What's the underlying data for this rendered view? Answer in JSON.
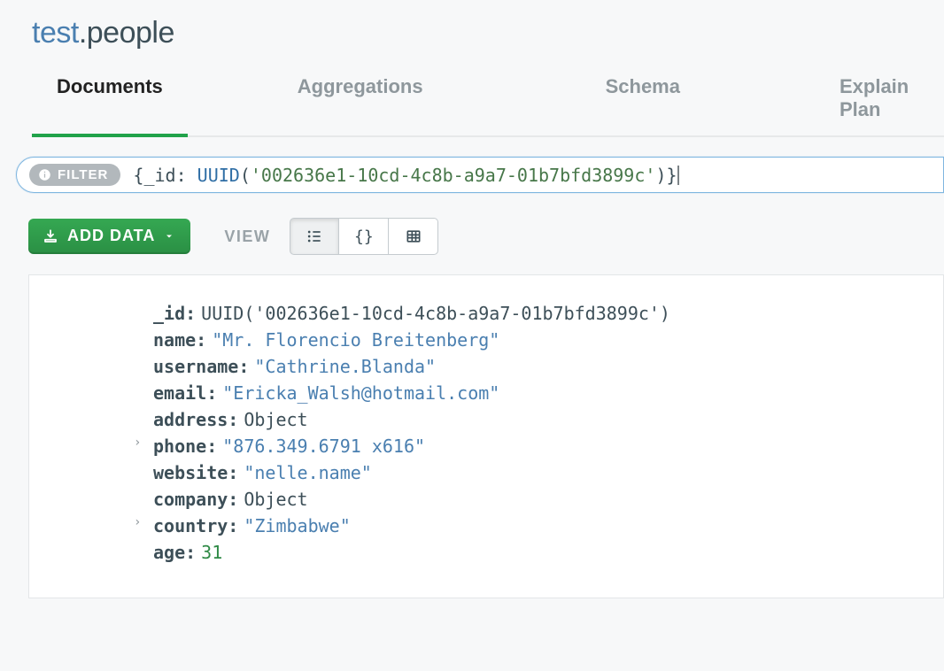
{
  "namespace": {
    "db": "test",
    "coll": ".people"
  },
  "tabs": [
    {
      "label": "Documents",
      "active": true
    },
    {
      "label": "Aggregations",
      "active": false
    },
    {
      "label": "Schema",
      "active": false
    },
    {
      "label": "Explain Plan",
      "active": false
    }
  ],
  "filter": {
    "chip_label": "FILTER",
    "query_tokens": {
      "open": "{",
      "field": "_id",
      "sep": ": ",
      "func": "UUID",
      "lparen": "(",
      "str": "'002636e1-10cd-4c8b-a9a7-01b7bfd3899c'",
      "rparen": ")",
      "close": "}"
    }
  },
  "toolbar": {
    "add_data_label": "ADD DATA",
    "view_label": "VIEW"
  },
  "document": {
    "fields": [
      {
        "key": "_id",
        "type": "func",
        "value": "UUID('002636e1-10cd-4c8b-a9a7-01b7bfd3899c')"
      },
      {
        "key": "name",
        "type": "string",
        "value": "\"Mr. Florencio Breitenberg\""
      },
      {
        "key": "username",
        "type": "string",
        "value": "\"Cathrine.Blanda\""
      },
      {
        "key": "email",
        "type": "string",
        "value": "\"Ericka_Walsh@hotmail.com\""
      },
      {
        "key": "address",
        "type": "object",
        "value": "Object",
        "expandable": true
      },
      {
        "key": "phone",
        "type": "string",
        "value": "\"876.349.6791 x616\""
      },
      {
        "key": "website",
        "type": "string",
        "value": "\"nelle.name\""
      },
      {
        "key": "company",
        "type": "object",
        "value": "Object",
        "expandable": true
      },
      {
        "key": "country",
        "type": "string",
        "value": "\"Zimbabwe\""
      },
      {
        "key": "age",
        "type": "number",
        "value": "31"
      }
    ]
  }
}
